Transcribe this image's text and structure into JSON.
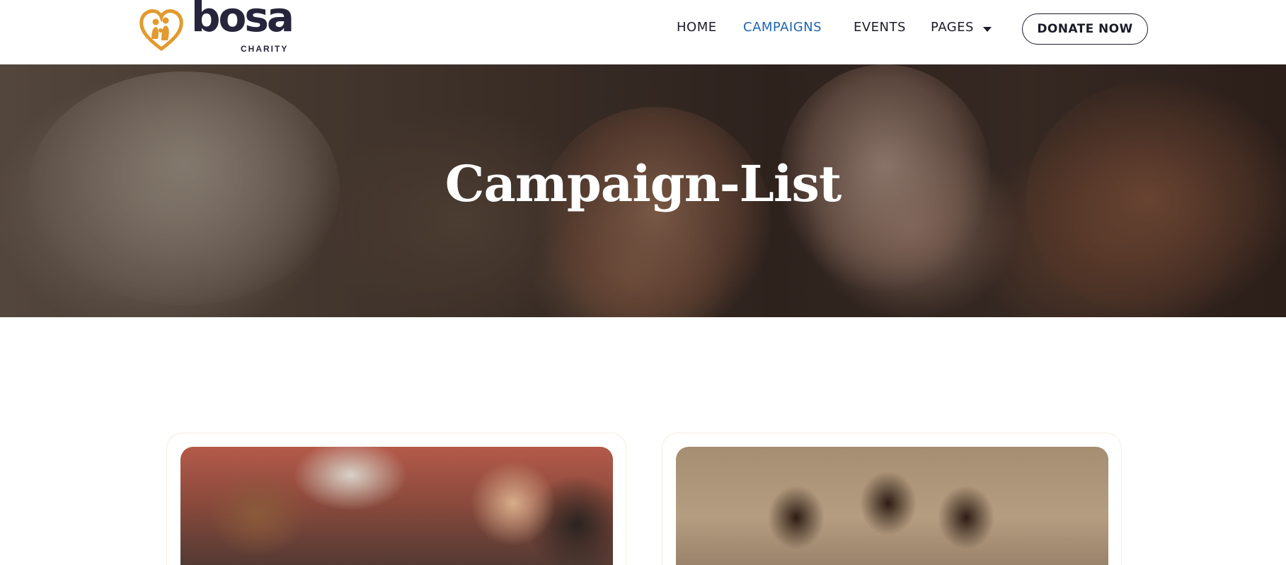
{
  "brand": {
    "name": "bosa",
    "subtitle": "CHARITY",
    "icon": "heart-family-icon",
    "colors": {
      "primary": "#26253c",
      "accent": "#e29a2e"
    }
  },
  "nav": {
    "items": [
      {
        "label": "HOME",
        "active": false
      },
      {
        "label": "CAMPAIGNS",
        "active": true
      },
      {
        "label": "EVENTS",
        "active": false
      },
      {
        "label": "PAGES",
        "active": false,
        "has_dropdown": true
      }
    ],
    "active_color": "#1e63b4",
    "cta_label": "DONATE NOW"
  },
  "hero": {
    "title": "Campaign-List",
    "image": "photo of smiling children reaching toward camera"
  },
  "campaigns": [
    {
      "image": "group of children smiling and making peace signs"
    },
    {
      "image": "three smiling children sitting against a wall"
    }
  ]
}
